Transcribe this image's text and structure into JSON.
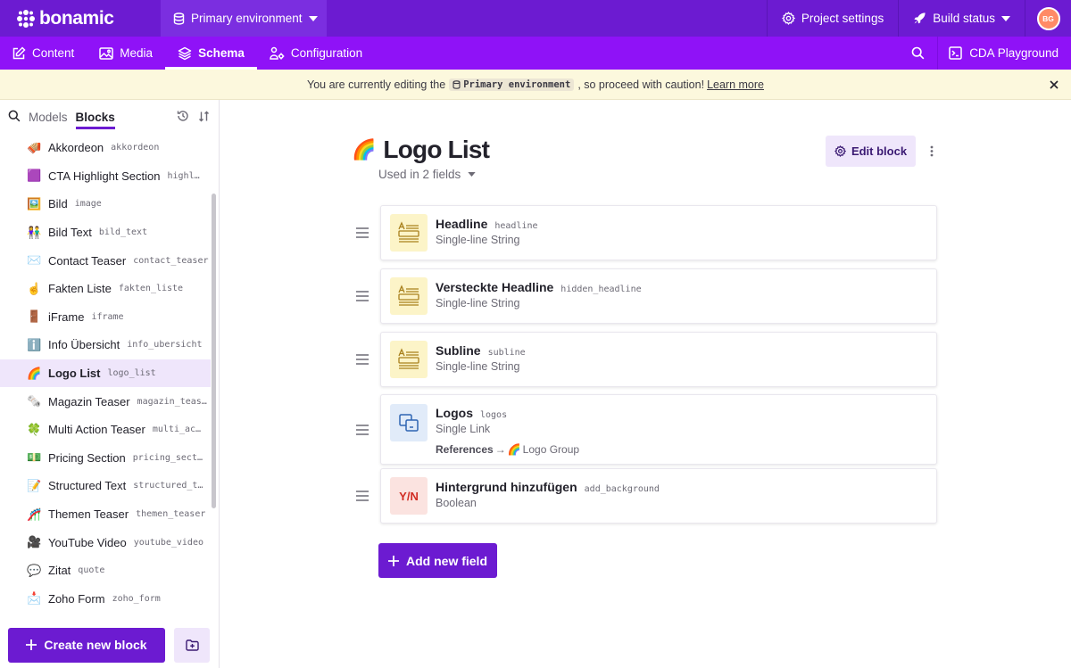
{
  "app": {
    "logo_text": "bonamic",
    "environment": "Primary environment",
    "project_settings": "Project settings",
    "build_status": "Build status",
    "avatar_initials": "BG"
  },
  "nav": {
    "tabs": [
      {
        "label": "Content",
        "active": false
      },
      {
        "label": "Media",
        "active": false
      },
      {
        "label": "Schema",
        "active": true
      },
      {
        "label": "Configuration",
        "active": false
      }
    ],
    "cda_playground": "CDA Playground"
  },
  "banner": {
    "prefix": "You are currently editing the",
    "env_chip": "Primary environment",
    "suffix": ", so proceed with caution!",
    "link": "Learn more"
  },
  "sidebar": {
    "tabs": [
      "Models",
      "Blocks"
    ],
    "active_tab": "Blocks",
    "items": [
      {
        "emoji": "🪗",
        "name": "Akkordeon",
        "api": "akkordeon"
      },
      {
        "emoji": "🟪",
        "name": "CTA Highlight Section",
        "api": "highl…"
      },
      {
        "emoji": "🖼️",
        "name": "Bild",
        "api": "image"
      },
      {
        "emoji": "👫",
        "name": "Bild Text",
        "api": "bild_text"
      },
      {
        "emoji": "✉️",
        "name": "Contact Teaser",
        "api": "contact_teaser"
      },
      {
        "emoji": "☝️",
        "name": "Fakten Liste",
        "api": "fakten_liste"
      },
      {
        "emoji": "🚪",
        "name": "iFrame",
        "api": "iframe"
      },
      {
        "emoji": "ℹ️",
        "name": "Info Übersicht",
        "api": "info_ubersicht"
      },
      {
        "emoji": "🌈",
        "name": "Logo List",
        "api": "logo_list",
        "active": true
      },
      {
        "emoji": "🗞️",
        "name": "Magazin Teaser",
        "api": "magazin_teas…"
      },
      {
        "emoji": "🍀",
        "name": "Multi Action Teaser",
        "api": "multi_ac…"
      },
      {
        "emoji": "💵",
        "name": "Pricing Section",
        "api": "pricing_sect…"
      },
      {
        "emoji": "📝",
        "name": "Structured Text",
        "api": "structured_t…"
      },
      {
        "emoji": "🎢",
        "name": "Themen Teaser",
        "api": "themen_teaser"
      },
      {
        "emoji": "🎥",
        "name": "YouTube Video",
        "api": "youtube_video"
      },
      {
        "emoji": "💬",
        "name": "Zitat",
        "api": "quote"
      },
      {
        "emoji": "📩",
        "name": "Zoho Form",
        "api": "zoho_form"
      }
    ],
    "create_button": "Create new block"
  },
  "main": {
    "title_emoji": "🌈",
    "title": "Logo List",
    "used_in": "Used in 2 fields",
    "edit_button": "Edit block",
    "fields": [
      {
        "name": "Headline",
        "api": "headline",
        "type": "Single-line String",
        "icon": "string"
      },
      {
        "name": "Versteckte Headline",
        "api": "hidden_headline",
        "type": "Single-line String",
        "icon": "string"
      },
      {
        "name": "Subline",
        "api": "subline",
        "type": "Single-line String",
        "icon": "string"
      },
      {
        "name": "Logos",
        "api": "logos",
        "type": "Single Link",
        "icon": "link",
        "ref_label": "References",
        "ref_arrow": "→",
        "ref_emoji": "🌈",
        "ref_target": "Logo Group"
      },
      {
        "name": "Hintergrund hinzufügen",
        "api": "add_background",
        "type": "Boolean",
        "icon": "boolean",
        "icon_text": "Y/N"
      }
    ],
    "add_field_button": "Add new field"
  },
  "colors": {
    "topbar": "#6c1bd1",
    "navbar": "#8f12f7",
    "accent": "#6c1bd1",
    "banner": "#fcf8dd"
  }
}
